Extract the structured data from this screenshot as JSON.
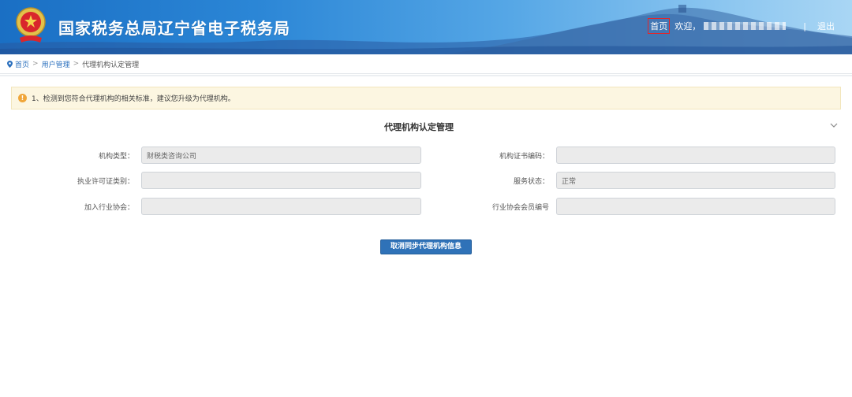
{
  "header": {
    "site_title": "国家税务总局辽宁省电子税务局",
    "home_label": "首页",
    "welcome_label": "欢迎，",
    "separator": "|",
    "logout_label": "退出",
    "emblem_icon": "tax-emblem-icon"
  },
  "breadcrumb": {
    "items": [
      "首页",
      "用户管理",
      "代理机构认定管理"
    ],
    "separator": ">"
  },
  "notice": {
    "icon": "warning-icon",
    "text": "1、检测到您符合代理机构的相关标准，建议您升级为代理机构。"
  },
  "section": {
    "title": "代理机构认定管理"
  },
  "form": {
    "rows": [
      {
        "left": {
          "label": "机构类型：",
          "value": "财税类咨询公司"
        },
        "right": {
          "label": "机构证书编码：",
          "value": ""
        }
      },
      {
        "left": {
          "label": "执业许可证类别：",
          "value": ""
        },
        "right": {
          "label": "服务状态：",
          "value": "正常"
        }
      },
      {
        "left": {
          "label": "加入行业协会：",
          "value": ""
        },
        "right": {
          "label": "行业协会会员编号",
          "value": ""
        }
      }
    ]
  },
  "actions": {
    "cancel_sync_label": "取消同步代理机构信息"
  },
  "colors": {
    "header_blue": "#1a6fc4",
    "primary_button": "#2f72b8",
    "notice_bg": "#fcf6e1",
    "link": "#2a6fbd"
  }
}
